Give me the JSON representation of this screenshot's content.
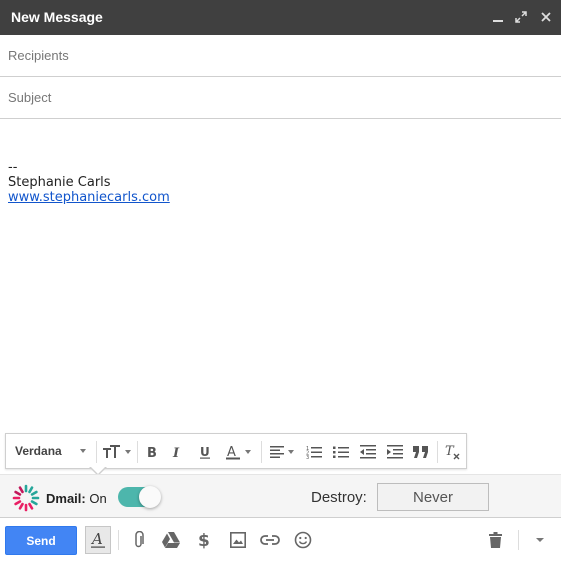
{
  "window": {
    "title": "New Message"
  },
  "fields": {
    "recipients_placeholder": "Recipients",
    "subject_placeholder": "Subject"
  },
  "body": {
    "separator": "--",
    "signature_name": "Stephanie Carls",
    "signature_link": "www.stephaniecarls.com"
  },
  "formatting": {
    "font": "Verdana",
    "tools": [
      "font-size",
      "bold",
      "italic",
      "underline",
      "text-color",
      "align",
      "numbered-list",
      "bulleted-list",
      "indent-less",
      "indent-more",
      "quote",
      "remove-formatting"
    ]
  },
  "dmail": {
    "label": "Dmail:",
    "state_text": "On",
    "enabled": true,
    "toggle_color": "#4db6ac",
    "destroy_label": "Destroy:",
    "destroy_value": "Never"
  },
  "bottom": {
    "send_label": "Send",
    "send_color": "#4285f4",
    "icons": [
      "formatting-icon",
      "attach-icon",
      "drive-icon",
      "money-icon",
      "photo-icon",
      "link-icon",
      "emoji-icon",
      "trash-icon",
      "more-options-icon"
    ]
  }
}
